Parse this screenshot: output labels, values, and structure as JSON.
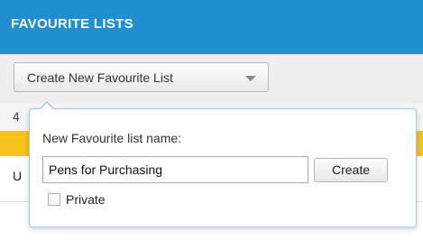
{
  "header": {
    "title": "FAVOURITE LISTS"
  },
  "toolbar": {
    "create_button_label": "Create New Favourite List"
  },
  "background": {
    "row1_text": "4",
    "row3_text": "U"
  },
  "popover": {
    "name_label": "New Favourite list name:",
    "name_value": "Pens for Purchasing",
    "create_label": "Create",
    "private_label": "Private",
    "private_checked": false
  },
  "colors": {
    "header_bg": "#1f8fcf",
    "highlight_row": "#f7c21c",
    "popover_border": "#a9c7e3"
  }
}
